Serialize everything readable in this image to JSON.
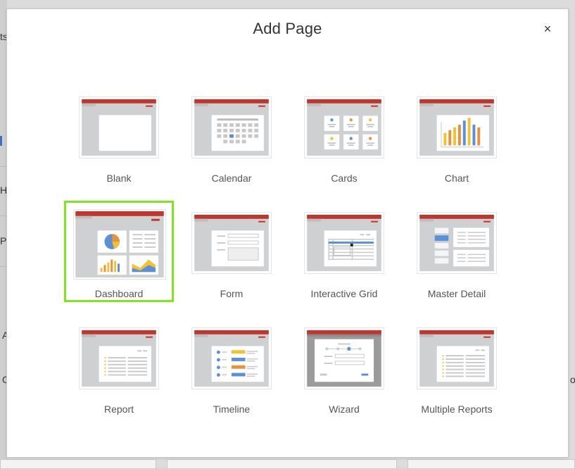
{
  "dialog": {
    "title": "Add Page",
    "close_label": "×"
  },
  "page_types": [
    {
      "label": "Blank",
      "icon": "blank-page-icon",
      "selected": false
    },
    {
      "label": "Calendar",
      "icon": "calendar-page-icon",
      "selected": false
    },
    {
      "label": "Cards",
      "icon": "cards-page-icon",
      "selected": false
    },
    {
      "label": "Chart",
      "icon": "chart-page-icon",
      "selected": false
    },
    {
      "label": "Dashboard",
      "icon": "dashboard-page-icon",
      "selected": true
    },
    {
      "label": "Form",
      "icon": "form-page-icon",
      "selected": false
    },
    {
      "label": "Interactive Grid",
      "icon": "interactive-grid-page-icon",
      "selected": false
    },
    {
      "label": "Master Detail",
      "icon": "master-detail-page-icon",
      "selected": false
    },
    {
      "label": "Report",
      "icon": "report-page-icon",
      "selected": false
    },
    {
      "label": "Timeline",
      "icon": "timeline-page-icon",
      "selected": false
    },
    {
      "label": "Wizard",
      "icon": "wizard-page-icon",
      "selected": false
    },
    {
      "label": "Multiple Reports",
      "icon": "multiple-reports-page-icon",
      "selected": false
    }
  ],
  "background": {
    "fragments": [
      "ts",
      "H",
      "P",
      "A",
      "C",
      "o"
    ]
  },
  "colors": {
    "header_red": "#c0362c",
    "selection_green": "#7fe61e",
    "thumb_gray": "#cfd0d1",
    "accent_blue": "#5b8fd9",
    "accent_orange": "#e8913a",
    "accent_yellow": "#f2c230"
  }
}
